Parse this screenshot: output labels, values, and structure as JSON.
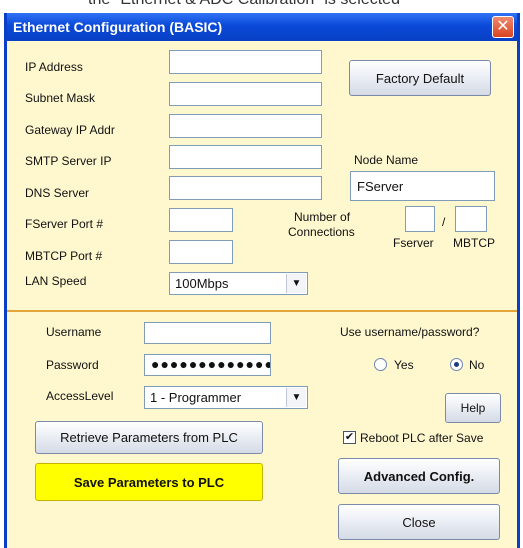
{
  "background_caption": "the \"Ethernet & ADC Calibration\" is selected",
  "window": {
    "title": "Ethernet Configuration (BASIC)",
    "close_glyph": "✕"
  },
  "network": {
    "ip_label": "IP Address",
    "ip_value": "",
    "subnet_label": "Subnet Mask",
    "subnet_value": "",
    "gateway_label": "Gateway IP Addr",
    "gateway_value": "",
    "smtp_label": "SMTP Server IP",
    "smtp_value": "",
    "dns_label": "DNS Server",
    "dns_value": "",
    "fserver_port_label": "FServer Port #",
    "fserver_port_value": "",
    "mbtcp_port_label": "MBTCP Port #",
    "mbtcp_port_value": "",
    "lan_speed_label": "LAN Speed",
    "lan_speed_value": "100Mbps",
    "factory_default_button": "Factory Default",
    "node_name_label": "Node Name",
    "node_name_value": "FServer",
    "connections_label_line1": "Number of",
    "connections_label_line2": "Connections",
    "fserver_conn_value": "",
    "mbtcp_conn_value": "",
    "conn_separator": "/",
    "fserver_caption": "Fserver",
    "mbtcp_caption": "MBTCP"
  },
  "security": {
    "username_label": "Username",
    "username_value": "",
    "password_label": "Password",
    "password_value": "●●●●●●●●●●●●●●●",
    "access_level_label": "AccessLevel",
    "access_level_value": "1 - Programmer",
    "use_auth_question": "Use username/password?",
    "yes_label": "Yes",
    "no_label": "No",
    "selected": "No"
  },
  "actions": {
    "help_button": "Help",
    "retrieve_button": "Retrieve Parameters from PLC",
    "reboot_label": "Reboot PLC after Save",
    "reboot_checked": true,
    "save_button": "Save Parameters to PLC",
    "advanced_button": "Advanced Config.",
    "close_button": "Close",
    "dropdown_arrow": "▼",
    "check_mark": "✔"
  }
}
